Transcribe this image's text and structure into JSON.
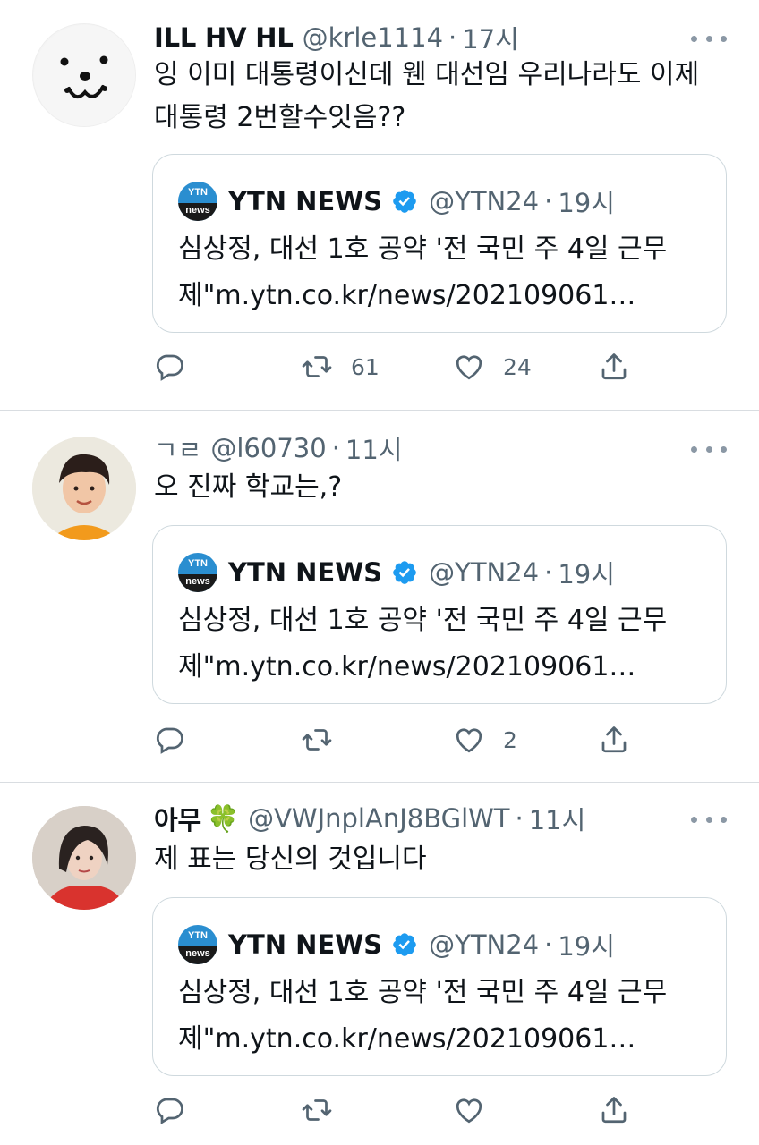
{
  "quoted": {
    "logo_top": "YTN",
    "logo_bottom": "news",
    "name": "YTN NEWS",
    "handle": "@YTN24",
    "time": "19시",
    "line1": "심상정, 대선 1호 공약 '전 국민 주 4일 근무",
    "line2": "제\"m.ytn.co.kr/news/202109061…"
  },
  "separator": "·",
  "colors": {
    "text": "#0f1419",
    "secondary": "#536471",
    "border": "#cfd9de",
    "verified": "#1d9bf0"
  },
  "tweets": [
    {
      "name": "ILL HV HL",
      "handle": "@krle1114",
      "time": "17시",
      "text_lines": [
        "잉 이미 대통령이신데 웬 대선임 우리나라도 이제",
        "대통령 2번할수잇음??"
      ],
      "avatar_icon": "dog-face-avatar",
      "retweets": "61",
      "likes": "24"
    },
    {
      "name": "ㄱㄹ",
      "handle": "@l60730",
      "time": "11시",
      "text_lines": [
        "오 진짜 학교는,?"
      ],
      "avatar_icon": "person-photo-avatar",
      "retweets": "",
      "likes": "2"
    },
    {
      "name": "아무",
      "name_emoji": "🍀",
      "handle": "@VWJnplAnJ8BGlWT",
      "time": "11시",
      "text_lines": [
        "제 표는 당신의 것입니다"
      ],
      "avatar_icon": "person-photo-avatar",
      "retweets": "",
      "likes": ""
    }
  ],
  "icons": [
    "reply-icon",
    "retweet-icon",
    "like-icon",
    "share-icon",
    "more-icon",
    "verified-icon"
  ]
}
